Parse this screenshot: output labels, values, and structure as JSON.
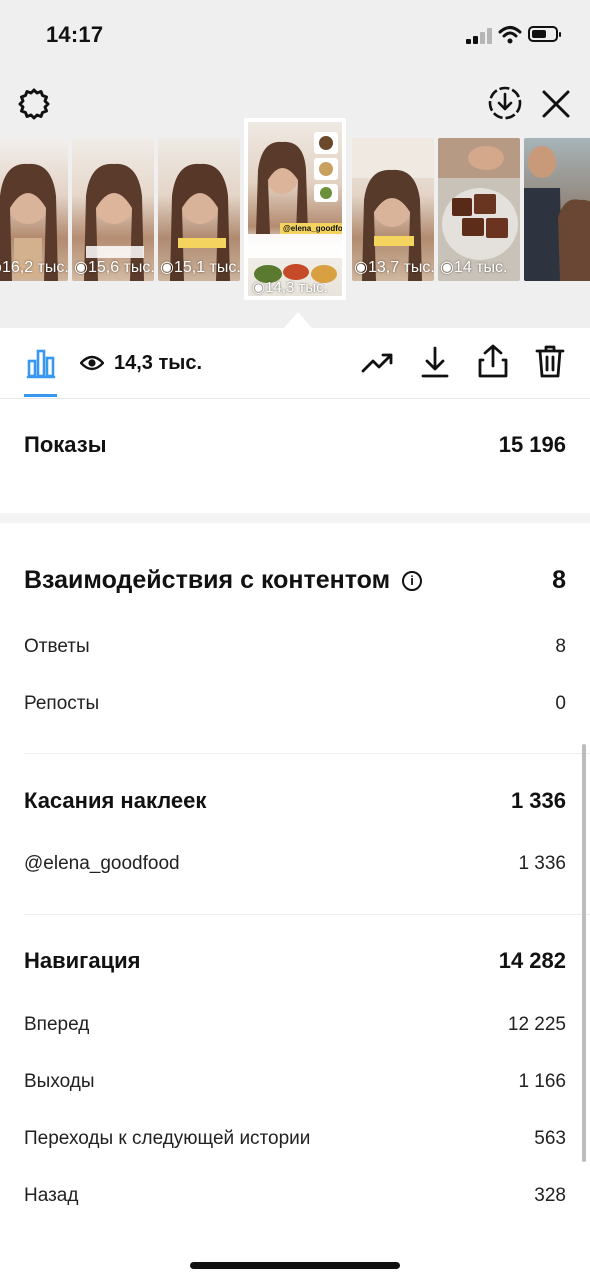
{
  "status": {
    "time": "14:17"
  },
  "toolbar": {
    "views": "14,3 тыс."
  },
  "thumbs": [
    {
      "views": "16,2 тыс."
    },
    {
      "views": "15,6 тыс."
    },
    {
      "views": "15,1 тыс."
    },
    {
      "views": "14,3 тыс.",
      "tag": "@elena_goodfood",
      "selected": true
    },
    {
      "views": "13,7 тыс."
    },
    {
      "views": "14 тыс."
    },
    {
      "views": ""
    }
  ],
  "impressions": {
    "label": "Показы",
    "value": "15 196"
  },
  "interactions": {
    "label": "Взаимодействия с контентом",
    "value": "8",
    "rows": [
      {
        "label": "Ответы",
        "value": "8"
      },
      {
        "label": "Репосты",
        "value": "0"
      }
    ]
  },
  "stickers": {
    "label": "Касания наклеек",
    "value": "1 336",
    "rows": [
      {
        "label": "@elena_goodfood",
        "value": "1 336"
      }
    ]
  },
  "navigation": {
    "label": "Навигация",
    "value": "14 282",
    "rows": [
      {
        "label": "Вперед",
        "value": "12 225"
      },
      {
        "label": "Выходы",
        "value": "1 166"
      },
      {
        "label": "Переходы к следующей истории",
        "value": "563"
      },
      {
        "label": "Назад",
        "value": "328"
      }
    ]
  },
  "colors": {
    "accent": "#3897f0",
    "topBg": "#efefef"
  }
}
